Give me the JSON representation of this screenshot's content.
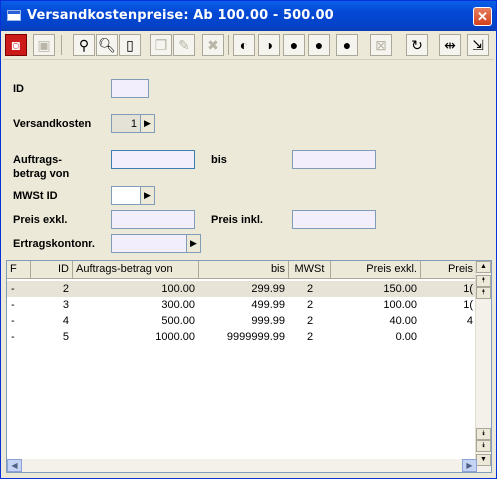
{
  "window": {
    "title": "Versandkostenpreise: Ab 100.00 - 500.00"
  },
  "toolbar": {
    "icons": [
      "binoculars-icon",
      "save-icon",
      "find-icon",
      "search-icon",
      "new-document-icon",
      "copy-icon",
      "edit-icon",
      "delete-icon",
      "record-first-icon",
      "record-prev-icon",
      "record-next-icon",
      "record-last-icon",
      "record-add-icon",
      "cancel-icon",
      "refresh-icon",
      "split-icon",
      "export-icon"
    ]
  },
  "form": {
    "id_label": "ID",
    "versandkosten_label": "Versandkosten",
    "versandkosten_value": "1",
    "auftrags_label_1": "Auftrags-",
    "auftrags_label_2": "betrag von",
    "bis_label": "bis",
    "mwst_label": "MWSt ID",
    "preis_exkl_label": "Preis exkl.",
    "preis_inkl_label": "Preis inkl.",
    "ertragskonto_label": "Ertragskontonr."
  },
  "grid": {
    "columns": [
      "F",
      "ID",
      "Auftrags-betrag von",
      "bis",
      "MWSt",
      "Preis exkl.",
      "Preis"
    ],
    "rows": [
      [
        "-",
        "2",
        "100.00",
        "299.99",
        "2",
        "150.00",
        "1("
      ],
      [
        "-",
        "3",
        "300.00",
        "499.99",
        "2",
        "100.00",
        "1("
      ],
      [
        "-",
        "4",
        "500.00",
        "999.99",
        "2",
        "40.00",
        "4"
      ],
      [
        "-",
        "5",
        "1000.00",
        "9999999.99",
        "2",
        "0.00",
        ""
      ]
    ]
  }
}
